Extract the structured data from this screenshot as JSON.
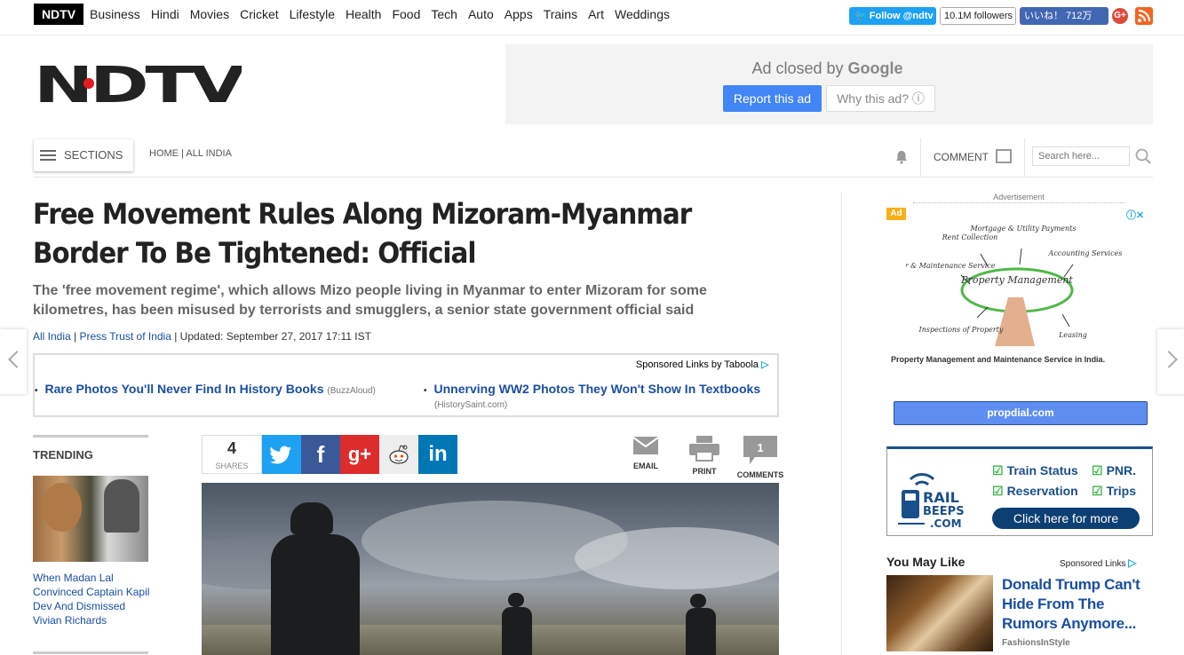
{
  "topnav": {
    "brand": "NDTV",
    "links": [
      "Business",
      "Hindi",
      "Movies",
      "Cricket",
      "Lifestyle",
      "Health",
      "Food",
      "Tech",
      "Auto",
      "Apps",
      "Trains",
      "Art",
      "Weddings"
    ],
    "twitter_follow": "Follow @ndtv",
    "twitter_followers": "10.1M followers",
    "facebook_like": "いいね！ 712万",
    "gplus": "G+"
  },
  "header": {
    "logo_text": "NDTV",
    "ad": {
      "closed_prefix": "Ad closed by",
      "closed_brand": "Google",
      "report_label": "Report this ad",
      "why_label": "Why this ad? ⓘ"
    }
  },
  "sectionbar": {
    "sections_label": "SECTIONS",
    "breadcrumb": "HOME | ALL INDIA",
    "comment_label": "COMMENT",
    "search_placeholder": "Search here..."
  },
  "article": {
    "headline": "Free Movement Rules Along Mizoram-Myanmar Border To Be Tightened: Official",
    "standfirst": "The 'free movement regime', which allows Mizo people living in Myanmar to enter Mizoram for some kilometres, has been misused by terrorists and smugglers, a senior state government official said",
    "byline": {
      "category": "All India",
      "sep1": " | ",
      "source": "Press Trust of India",
      "updated": " | Updated: September 27, 2017 17:11 IST"
    }
  },
  "taboola": {
    "sponsored_label": "Sponsored Links by Taboola",
    "items": [
      {
        "title": "Rare Photos You'll Never Find In History Books",
        "source": "(BuzzAloud)"
      },
      {
        "title": "Unnerving WW2 Photos They Won't Show In Textbooks",
        "source": "(HistorySaint.com)"
      }
    ]
  },
  "trending": {
    "title": "TRENDING",
    "story": "When Madan Lal Convinced Captain Kapil Dev And Dismissed Vivian Richards"
  },
  "share": {
    "count": "4",
    "count_label": "SHARES",
    "buttons": [
      "twitter",
      "facebook",
      "google-plus",
      "reddit",
      "linkedin"
    ],
    "email_label": "EMAIL",
    "print_label": "PRINT",
    "comments_label": "COMMENTS",
    "comments_count": "1"
  },
  "sidebar": {
    "advertisement_label": "Advertisement",
    "ad_badge": "Ad",
    "diagram": {
      "center": "Property Management",
      "nodes": [
        "Rent Collection",
        "Mortgage & Utility Payments",
        "Accounting Services",
        "Repair & Maintenance Service",
        "Inspections of Property",
        "Leasing"
      ]
    },
    "ad_caption": "Property Management and Maintenance Service in India.",
    "ad_button": "propdial.com",
    "rail": {
      "logo_top": "RAIL",
      "logo_bottom": "BEEPS",
      "logo_suffix": ".COM",
      "items": [
        "Train Status",
        "PNR.",
        "Reservation",
        "Trips"
      ],
      "cta": "Click here for more"
    },
    "you_may_like": {
      "title": "You May Like",
      "sponsored": "Sponsored Links",
      "story_title": "Donald Trump Can't Hide From The Rumors Anymore...",
      "story_source": "FashionsInStyle"
    }
  },
  "colors": {
    "link_blue": "#1a4ea1",
    "ndtv_red": "#e21b23",
    "twitter": "#1da1f2",
    "facebook": "#3b5998",
    "googleplus": "#dd4b39",
    "linkedin": "#0077b5",
    "google_ad_blue": "#4285f4"
  }
}
